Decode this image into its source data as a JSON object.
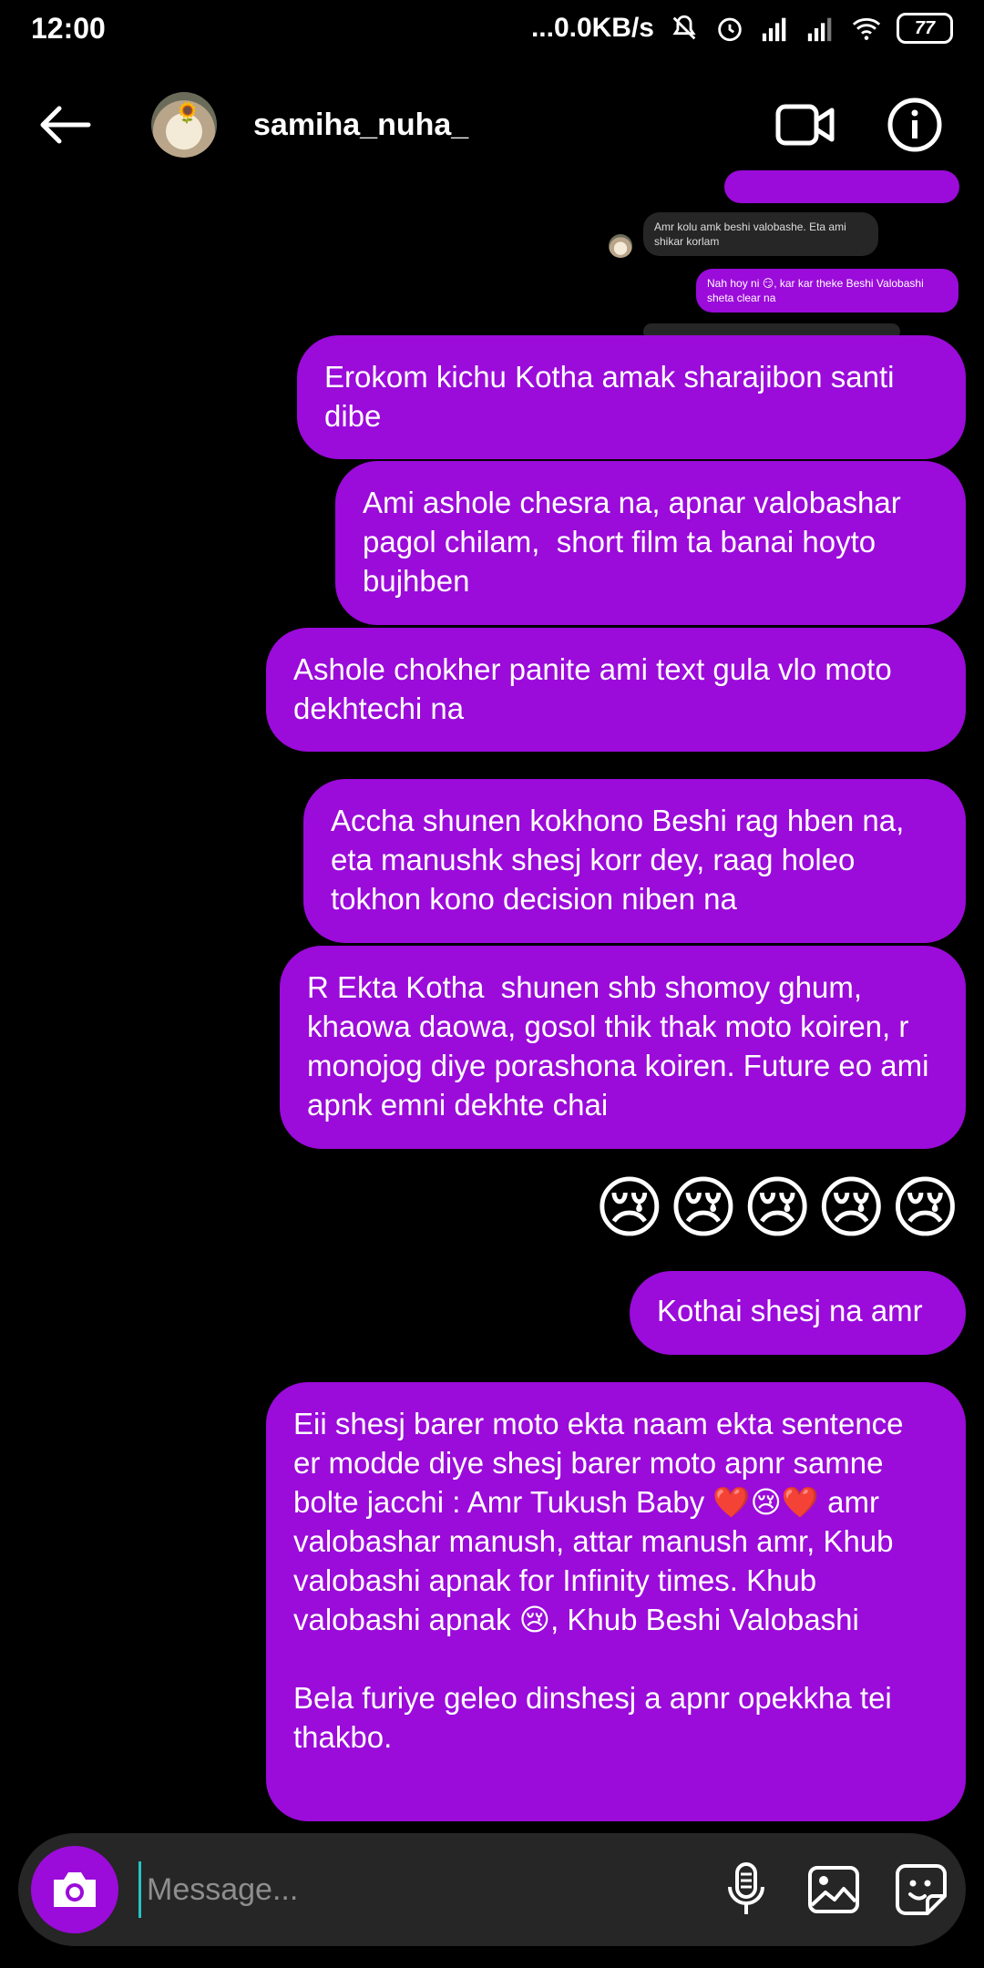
{
  "status_bar": {
    "time": "12:00",
    "network_speed": "...0.0KB/s",
    "battery": "77"
  },
  "header": {
    "username": "samiha_nuha_",
    "back_icon": "arrow-left-icon",
    "video_icon": "video-call-icon",
    "info_icon": "info-icon"
  },
  "messages": {
    "in_small_1": "Amr kolu amk beshi valobashe. Eta ami shikar korlam",
    "out_small_1": "Nah hoy ni 😏, kar kar theke Beshi Valobashi sheta clear na",
    "m1": "Erokom kichu Kotha amak sharajibon santi dibe",
    "m2": "Ami ashole chesra na, apnar valobashar pagol chilam,  short film ta banai hoyto bujhben",
    "m3": "Ashole chokher panite ami text gula vlo moto dekhtechi na",
    "m4": "Accha shunen kokhono Beshi rag hben na, eta manushk shesj korr dey, raag holeo tokhon kono decision niben na",
    "m5": "R Ekta Kotha  shunen shb shomoy ghum, khaowa daowa, gosol thik thak moto koiren, r monojog diye porashona koiren. Future eo ami apnk emni dekhte chai",
    "emojis": "😢😢😢😢😢",
    "m6": "Kothai shesj na amr",
    "m7": "Eii shesj barer moto ekta naam ekta sentence er modde diye shesj barer moto apnr samne bolte jacchi : Amr Tukush Baby ❤️😢❤️ amr valobashar manush, attar manush amr, Khub valobashi apnak for Infinity times. Khub valobashi apnak 😢, Khub Beshi Valobashi\n\nBela furiye geleo dinshesj a apnr opekkha tei thakbo."
  },
  "composer": {
    "placeholder": "Message...",
    "camera_icon": "camera-icon",
    "mic_icon": "microphone-icon",
    "gallery_icon": "gallery-icon",
    "sticker_icon": "sticker-icon"
  },
  "colors": {
    "bubble": "#9b0bda",
    "background": "#000000",
    "input_bg": "#262626"
  }
}
